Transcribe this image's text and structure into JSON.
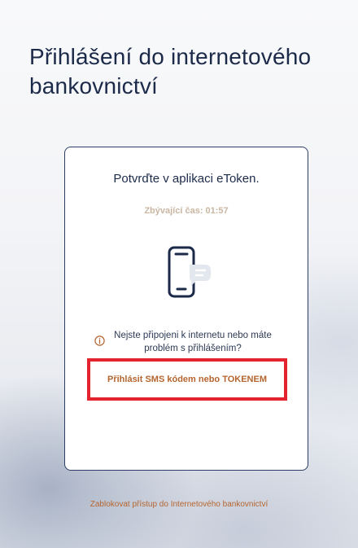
{
  "page": {
    "title": "Přihlášení do internetového bankovnictví"
  },
  "card": {
    "prompt": "Potvrďte v aplikaci eToken.",
    "timer": "Zbývající čas: 01:57",
    "icon": "phone-message-icon",
    "info_icon": "info-icon",
    "info_text": "Nejste připojeni k internetu nebo máte problém s přihlášením?",
    "sms_link": "Přihlásit SMS kódem nebo TOKENEM"
  },
  "footer": {
    "block_link": "Zablokovat přístup do Internetového bankovnictví"
  },
  "colors": {
    "navy": "#1c2a4a",
    "accent_link": "#b5652f",
    "highlight_box": "#e3232e",
    "timer": "#c9b7a3"
  }
}
